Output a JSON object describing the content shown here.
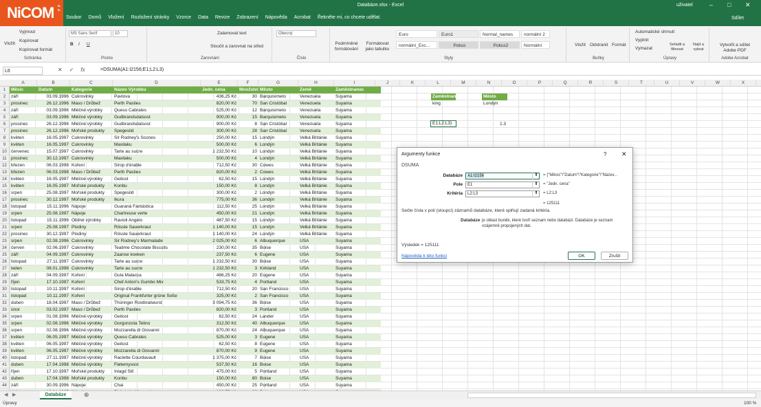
{
  "app": {
    "logo": "NiCOM",
    "logo_small": "a.s.",
    "doc_title": "Databáze.xlsx - Excel",
    "user": "uživatel",
    "share": "Sdílet",
    "menus": [
      "Soubor",
      "Domů",
      "Vložení",
      "Rozložení stránky",
      "Vzorce",
      "Data",
      "Revize",
      "Zobrazení",
      "Nápověda",
      "Acrobat",
      "Řekněte mi, co chcete udělat."
    ]
  },
  "ribbon": {
    "clipboard": {
      "label": "Schránka",
      "paste": "Vložit",
      "cut": "Vyjmout",
      "copy": "Kopírovat",
      "format": "Kopírovat formát"
    },
    "font": {
      "label": "Písmo",
      "name": "MS Sans Serif",
      "size": "10"
    },
    "alignment": {
      "label": "Zarovnání",
      "wrap": "Zalamovat text",
      "merge": "Sloučit a zarovnat na střed"
    },
    "number": {
      "label": "Číslo",
      "format": "Obecný"
    },
    "styles": {
      "label": "Styly",
      "cond": "Podmíněné formátování",
      "table": "Formátovat jako tabulku",
      "items": [
        "Euro",
        "Euro1",
        "Normal_names",
        "normální 2",
        "normální_Exc...",
        "Pokus",
        "Pokus2",
        "Normální"
      ]
    },
    "cells": {
      "label": "Buňky",
      "insert": "Vložit",
      "delete": "Odstranit",
      "format": "Formát"
    },
    "editing": {
      "label": "Úpravy",
      "autosum": "Automatické shrnutí",
      "fill": "Vyplnit",
      "clear": "Vymazat",
      "sort": "Seřadit a filtrovat",
      "find": "Najít a vybrat"
    },
    "acrobat": {
      "label": "Adobe Acrobat",
      "create": "Vytvořit a sdílet Adobe PDF"
    }
  },
  "formula_bar": {
    "name_box": "L6",
    "formula": "=DSUMA(A1:I2156;E1;L2:L3)"
  },
  "columns": [
    "A",
    "B",
    "C",
    "D",
    "E",
    "F",
    "G",
    "H",
    "I",
    "J",
    "K",
    "L",
    "M",
    "N",
    "O",
    "P",
    "Q",
    "R",
    "S",
    "T",
    "U",
    "V",
    "W",
    "X"
  ],
  "headers": [
    "Měsíc",
    "Datum",
    "Kategorie",
    "Název Výrobku",
    "Jedn. cena",
    "Množství",
    "Město",
    "Země",
    "Zaměstnanec"
  ],
  "rows": [
    [
      "září",
      "03.09.1996",
      "Cukrovinky",
      "Pavlova",
      "436,25 Kč",
      "30",
      "Barquisimeto",
      "Venezuela",
      "Suyama"
    ],
    [
      "prosinec",
      "26.12.1996",
      "Maso / Drůbež",
      "Perth Pasties",
      "820,00 Kč",
      "70",
      "San Cristóbal",
      "Venezuela",
      "Suyama"
    ],
    [
      "září",
      "03.09.1996",
      "Mléčné výrobky",
      "Queso Cabrales",
      "525,00 Kč",
      "12",
      "Barquisimeto",
      "Venezuela",
      "Suyama"
    ],
    [
      "září",
      "03.09.1996",
      "Mléčné výrobky",
      "Gudbrandsdalsost",
      "900,00 Kč",
      "15",
      "Barquisimeto",
      "Venezuela",
      "Suyama"
    ],
    [
      "prosinec",
      "26.12.1996",
      "Mléčné výrobky",
      "Gudbrandsdalsost",
      "900,00 Kč",
      "8",
      "San Cristóbal",
      "Venezuela",
      "Suyama"
    ],
    [
      "prosinec",
      "26.12.1996",
      "Mořské produkty",
      "Spegesild",
      "300,00 Kč",
      "28",
      "San Cristóbal",
      "Venezuela",
      "Suyama"
    ],
    [
      "květen",
      "16.05.1997",
      "Cukrovinky",
      "Sir Rodney's Scones",
      "250,00 Kč",
      "15",
      "Londýn",
      "Velká Británie",
      "Suyama"
    ],
    [
      "květen",
      "16.05.1997",
      "Cukrovinky",
      "Maxilaku",
      "500,00 Kč",
      "6",
      "Londýn",
      "Velká Británie",
      "Suyama"
    ],
    [
      "červenec",
      "15.07.1997",
      "Cukrovinky",
      "Tarte au sucre",
      "1 232,50 Kč",
      "10",
      "Londýn",
      "Velká Británie",
      "Suyama"
    ],
    [
      "prosinec",
      "30.12.1997",
      "Cukrovinky",
      "Maxilaku",
      "500,00 Kč",
      "4",
      "Londýn",
      "Velká Británie",
      "Suyama"
    ],
    [
      "březen",
      "06.03.1998",
      "Koření",
      "Sirop d'érable",
      "712,50 Kč",
      "30",
      "Cowes",
      "Velká Británie",
      "Suyama"
    ],
    [
      "březen",
      "06.03.1998",
      "Maso / Drůbež",
      "Perth Pasties",
      "820,00 Kč",
      "2",
      "Cowes",
      "Velká Británie",
      "Suyama"
    ],
    [
      "květen",
      "16.05.1997",
      "Mléčné výrobky",
      "Geitost",
      "62,50 Kč",
      "15",
      "Londýn",
      "Velká Británie",
      "Suyama"
    ],
    [
      "květen",
      "16.05.1997",
      "Mořské produkty",
      "Konbu",
      "150,00 Kč",
      "8",
      "Londýn",
      "Velká Británie",
      "Suyama"
    ],
    [
      "srpen",
      "25.08.1997",
      "Mořské produkty",
      "Spegesild",
      "300,00 Kč",
      "2",
      "Londýn",
      "Velká Británie",
      "Suyama"
    ],
    [
      "prosinec",
      "30.12.1997",
      "Mořské produkty",
      "Ikura",
      "775,00 Kč",
      "36",
      "Londýn",
      "Velká Británie",
      "Suyama"
    ],
    [
      "listopad",
      "15.11.1996",
      "Nápoje",
      "Guaraná Fantástica",
      "112,50 Kč",
      "25",
      "Londýn",
      "Velká Británie",
      "Suyama"
    ],
    [
      "srpen",
      "25.08.1997",
      "Nápoje",
      "Chartreuse verte",
      "450,00 Kč",
      "21",
      "Londýn",
      "Velká Británie",
      "Suyama"
    ],
    [
      "listopad",
      "15.11.1996",
      "Obilné výrobky",
      "Ravioli Angelo",
      "487,50 Kč",
      "15",
      "Londýn",
      "Velká Británie",
      "Suyama"
    ],
    [
      "srpen",
      "25.08.1997",
      "Plodiny",
      "Rössle Sauerkraut",
      "1 140,00 Kč",
      "15",
      "Londýn",
      "Velká Británie",
      "Suyama"
    ],
    [
      "prosinec",
      "30.12.1997",
      "Plodiny",
      "Rössle Sauerkraut",
      "1 140,00 Kč",
      "24",
      "Londýn",
      "Velká Británie",
      "Suyama"
    ],
    [
      "srpen",
      "02.08.1996",
      "Cukrovinky",
      "Sir Rodney's Marmalade",
      "2 025,00 Kč",
      "6",
      "Albuquerque",
      "USA",
      "Suyama"
    ],
    [
      "červen",
      "02.06.1997",
      "Cukrovinky",
      "Teatime Chocolate Biscuits",
      "230,00 Kč",
      "35",
      "Boise",
      "USA",
      "Suyama"
    ],
    [
      "září",
      "04.09.1997",
      "Cukrovinky",
      "Zaanse koeken",
      "237,50 Kč",
      "6",
      "Eugene",
      "USA",
      "Suyama"
    ],
    [
      "listopad",
      "27.11.1997",
      "Cukrovinky",
      "Tarte au sucre",
      "1 232,50 Kč",
      "30",
      "Boise",
      "USA",
      "Suyama"
    ],
    [
      "leden",
      "08.01.1998",
      "Cukrovinky",
      "Tarte au sucre",
      "1 232,50 Kč",
      "3",
      "Kirkland",
      "USA",
      "Suyama"
    ],
    [
      "září",
      "04.09.1997",
      "Koření",
      "Gula Malacca",
      "486,25 Kč",
      "20",
      "Eugene",
      "USA",
      "Suyama"
    ],
    [
      "říjen",
      "17.10.1997",
      "Koření",
      "Chef Anton's Gumbo Mix",
      "533,75 Kč",
      "4",
      "Portland",
      "USA",
      "Suyama"
    ],
    [
      "listopad",
      "10.11.1997",
      "Koření",
      "Sirop d'érable",
      "712,50 Kč",
      "20",
      "San Francisco",
      "USA",
      "Suyama"
    ],
    [
      "listopad",
      "10.11.1997",
      "Koření",
      "Original Frankfurter grüne Soße",
      "325,00 Kč",
      "2",
      "San Francisco",
      "USA",
      "Suyama"
    ],
    [
      "duben",
      "18.04.1997",
      "Maso / Drůbež",
      "Thüringer Rostbratwurst",
      "3 094,75 Kč",
      "36",
      "Boise",
      "USA",
      "Suyama"
    ],
    [
      "únor",
      "03.02.1997",
      "Maso / Drůbež",
      "Perth Pasties",
      "820,00 Kč",
      "3",
      "Portland",
      "USA",
      "Suyama"
    ],
    [
      "srpen",
      "01.08.1996",
      "Mléčné výrobky",
      "Geitost",
      "62,50 Kč",
      "24",
      "Lander",
      "USA",
      "Suyama"
    ],
    [
      "srpen",
      "02.08.1996",
      "Mléčné výrobky",
      "Gorgonzola Telino",
      "312,50 Kč",
      "40",
      "Albuquerque",
      "USA",
      "Suyama"
    ],
    [
      "srpen",
      "02.08.1996",
      "Mléčné výrobky",
      "Mozzarella di Giovanni",
      "870,00 Kč",
      "24",
      "Albuquerque",
      "USA",
      "Suyama"
    ],
    [
      "květen",
      "06.05.1997",
      "Mléčné výrobky",
      "Queso Cabrales",
      "525,00 Kč",
      "3",
      "Eugene",
      "USA",
      "Suyama"
    ],
    [
      "květen",
      "06.05.1997",
      "Mléčné výrobky",
      "Geitost",
      "62,50 Kč",
      "8",
      "Eugene",
      "USA",
      "Suyama"
    ],
    [
      "květen",
      "06.05.1997",
      "Mléčné výrobky",
      "Mozzarella di Giovanni",
      "870,00 Kč",
      "9",
      "Eugene",
      "USA",
      "Suyama"
    ],
    [
      "listopad",
      "27.11.1997",
      "Mléčné výrobky",
      "Raclette Courdavault",
      "1 375,00 Kč",
      "7",
      "Boise",
      "USA",
      "Suyama"
    ],
    [
      "duben",
      "17.04.1998",
      "Mléčné výrobky",
      "Fløtemysost",
      "537,50 Kč",
      "16",
      "Boise",
      "USA",
      "Suyama"
    ],
    [
      "říjen",
      "17.10.1997",
      "Mořské produkty",
      "Inlagd Sill",
      "475,00 Kč",
      "5",
      "Portland",
      "USA",
      "Suyama"
    ],
    [
      "duben",
      "17.04.1998",
      "Mořské produkty",
      "Konbu",
      "150,00 Kč",
      "80",
      "Boise",
      "USA",
      "Suyama"
    ],
    [
      "září",
      "30.09.1996",
      "Nápoje",
      "Chai",
      "450,00 Kč",
      "25",
      "Portland",
      "USA",
      "Suyama"
    ],
    [
      "duben",
      "18.04.1997",
      "Nápoje",
      "Rhönbräu Klosterbier",
      "193,75 Kč",
      "36",
      "Boise",
      "USA",
      "Suyama"
    ]
  ],
  "criteria": {
    "l_header": "Zaměstnanec",
    "l_value": "king",
    "n_header": "Město",
    "n_value": "Londýn",
    "l6": "E1;L2:L3)",
    "n6": "1.3"
  },
  "sheet_tab": "Databáze",
  "status": "Úpravy",
  "zoom": "100 %",
  "dialog": {
    "title": "Argumenty funkce",
    "help": "?",
    "function": "DSUMA",
    "args": [
      {
        "label": "Databáze",
        "value": "A1:I2156",
        "result": "{\"Měsíc\"\\\"Datum\"\\\"Kategorie\"\\\"Název..."
      },
      {
        "label": "Pole",
        "value": "E1",
        "result": "\"Jedn. cena\""
      },
      {
        "label": "Kritéria",
        "value": "L2:L3",
        "result": "L2:L3"
      }
    ],
    "eq": "=",
    "result_total": "= 125111",
    "desc": "Sečte čísla v poli (sloupci) záznamů databáze, které splňují zadaná kritéria.",
    "arg_desc_label": "Databáze",
    "arg_desc": "je oblast buněk, které tvoří seznam nebo databázi. Databáze je seznam vzájemně propojených dat.",
    "result_label": "Výsledek =",
    "result_value": "125111",
    "help_link": "Nápověda k této funkci",
    "ok": "OK",
    "cancel": "Zrušit"
  }
}
